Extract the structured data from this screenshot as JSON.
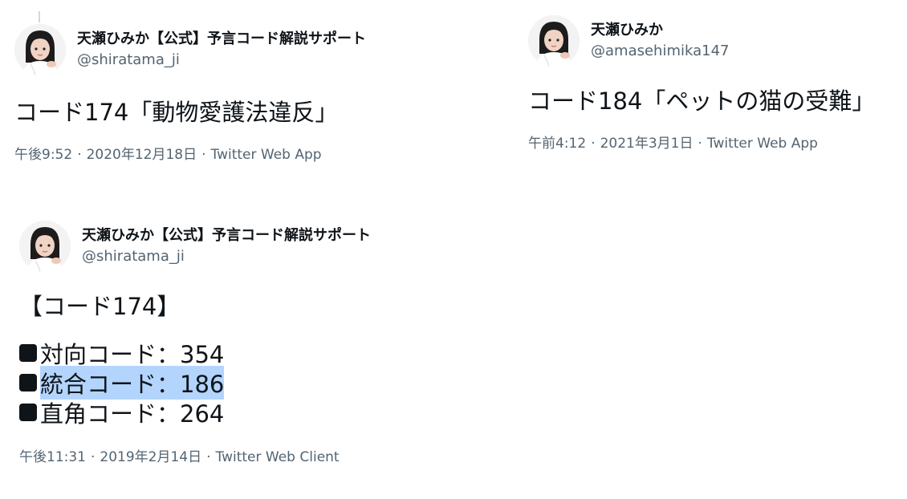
{
  "tweet1": {
    "display_name": "天瀬ひみか【公式】予言コード解説サポート",
    "handle": "@shiratama_ji",
    "text": "コード174「動物愛護法違反」",
    "time": "午後9:52",
    "date": "2020年12月18日",
    "client": "Twitter Web App"
  },
  "tweet2": {
    "display_name": "天瀬ひみか",
    "handle": "@amasehimika147",
    "text": "コード184「ペットの猫の受難」",
    "time": "午前4:12",
    "date": "2021年3月1日",
    "client": "Twitter Web App"
  },
  "tweet3": {
    "display_name": "天瀬ひみか【公式】予言コード解説サポート",
    "handle": "@shiratama_ji",
    "title": "【コード174】",
    "lines": [
      {
        "label": "対向コード：354"
      },
      {
        "label": "統合コード：186"
      },
      {
        "label": "直角コード：264"
      }
    ],
    "time": "午後11:31",
    "date": "2019年2月14日",
    "client": "Twitter Web Client"
  },
  "meta_separator": "·",
  "colors": {
    "text": "#0f1419",
    "secondary": "#536471",
    "selection": "#b3d4fc"
  }
}
